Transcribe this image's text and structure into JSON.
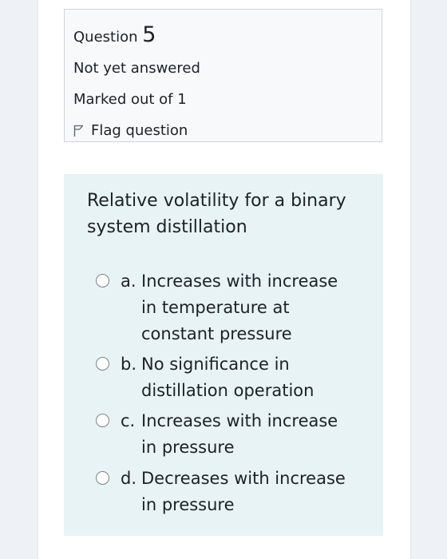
{
  "question": {
    "label": "Question",
    "number": "5",
    "state": "Not yet answered",
    "grade": "Marked out of 1",
    "flag_label": "Flag question",
    "text": "Relative volatility for a binary system distillation"
  },
  "options": [
    {
      "letter": "a.",
      "text": "Increases with increase in temperature at constant pressure"
    },
    {
      "letter": "b.",
      "text": "No significance in distillation operation"
    },
    {
      "letter": "c.",
      "text": "Increases with increase in pressure"
    },
    {
      "letter": "d.",
      "text": "Decreases with increase in pressure"
    }
  ],
  "colors": {
    "info_background": "#f8f9fa",
    "content_background": "#e7f3f5",
    "page_background": "#eef2f7"
  }
}
